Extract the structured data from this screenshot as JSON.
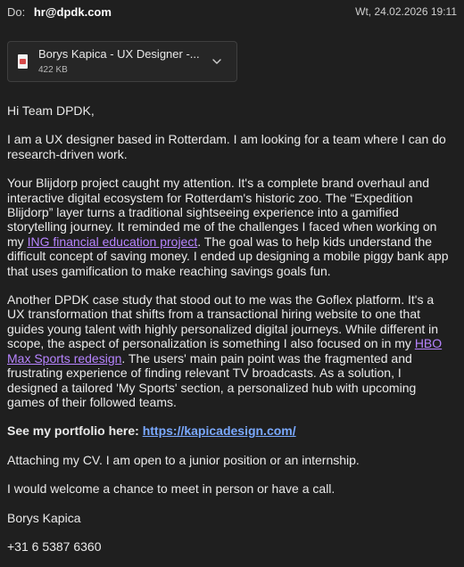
{
  "header": {
    "to_label": "Do:",
    "to_email": "hr@dpdk.com",
    "date": "Wt, 24.02.2026 19:11"
  },
  "attachment": {
    "icon": "pdf-file-icon",
    "name": "Borys Kapica - UX Designer -...",
    "size": "422 KB"
  },
  "message": {
    "greeting": "Hi Team DPDK,",
    "intro": "I am a UX designer based in Rotterdam. I am looking for a team where I can do research-driven work.",
    "p2": {
      "before_link": "Your Blijdorp project caught my attention. It's a complete brand overhaul and interactive digital ecosystem for Rotterdam's historic zoo. The “Expedition Blijdorp” layer turns a traditional sightseeing experience into a gamified storytelling journey. It reminded me of the challenges I faced when working on my ",
      "link_text": "ING financial education project",
      "after_link": ". The goal was to help kids understand the difficult concept of saving money. I ended up designing a mobile piggy bank app that uses gamification to make reaching savings goals fun."
    },
    "p3": {
      "before_link": "Another DPDK case study that stood out to me was the Goflex platform. It's a UX transformation that shifts from a transactional hiring website to one that guides young talent with highly personalized digital journeys. While different in scope, the aspect of personalization is something I also focused on in my ",
      "link_text": "HBO Max Sports redesign",
      "after_link": ". The users' main pain point was the fragmented and frustrating experience of finding relevant TV broadcasts. As a solution, I designed a tailored 'My Sports' section, a personalized hub with upcoming games of their followed teams."
    },
    "portfolio": {
      "label": "See my portfolio here: ",
      "url_text": "https://kapicadesign.com/"
    },
    "attach_note": "Attaching my CV. I am open to a junior position or an internship.",
    "meet_note": "I would welcome a chance to meet in person or have a call.",
    "signature_name": "Borys Kapica",
    "phone": "+31 6 5387 6360"
  },
  "colors": {
    "background": "#1f1f1f",
    "link_purple": "#b784ff",
    "link_blue": "#7aa9ff"
  }
}
